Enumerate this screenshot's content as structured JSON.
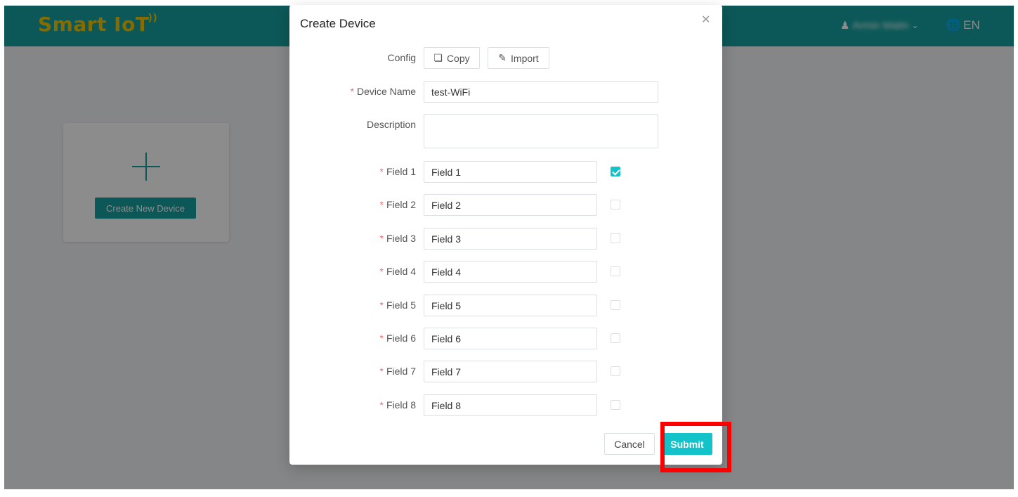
{
  "header": {
    "logo": "Smart IoT",
    "user_name": "Armin Matin",
    "language": "EN"
  },
  "card": {
    "create_label": "Create New Device"
  },
  "modal": {
    "title": "Create Device",
    "config_label": "Config",
    "copy_label": "Copy",
    "import_label": "Import",
    "device_name_label": "Device Name",
    "device_name_value": "test-WiFi",
    "description_label": "Description",
    "description_value": "",
    "fields": [
      {
        "label": "Field 1",
        "value": "Field 1",
        "checked": true
      },
      {
        "label": "Field 2",
        "value": "Field 2",
        "checked": false
      },
      {
        "label": "Field 3",
        "value": "Field 3",
        "checked": false
      },
      {
        "label": "Field 4",
        "value": "Field 4",
        "checked": false
      },
      {
        "label": "Field 5",
        "value": "Field 5",
        "checked": false
      },
      {
        "label": "Field 6",
        "value": "Field 6",
        "checked": false
      },
      {
        "label": "Field 7",
        "value": "Field 7",
        "checked": false
      },
      {
        "label": "Field 8",
        "value": "Field 8",
        "checked": false
      }
    ],
    "cancel_label": "Cancel",
    "submit_label": "Submit"
  },
  "colors": {
    "header": "#16a1a1",
    "accent": "#14c2c9",
    "logo": "#f2c400",
    "required": "#f56c6c",
    "highlight": "#ff0000"
  }
}
